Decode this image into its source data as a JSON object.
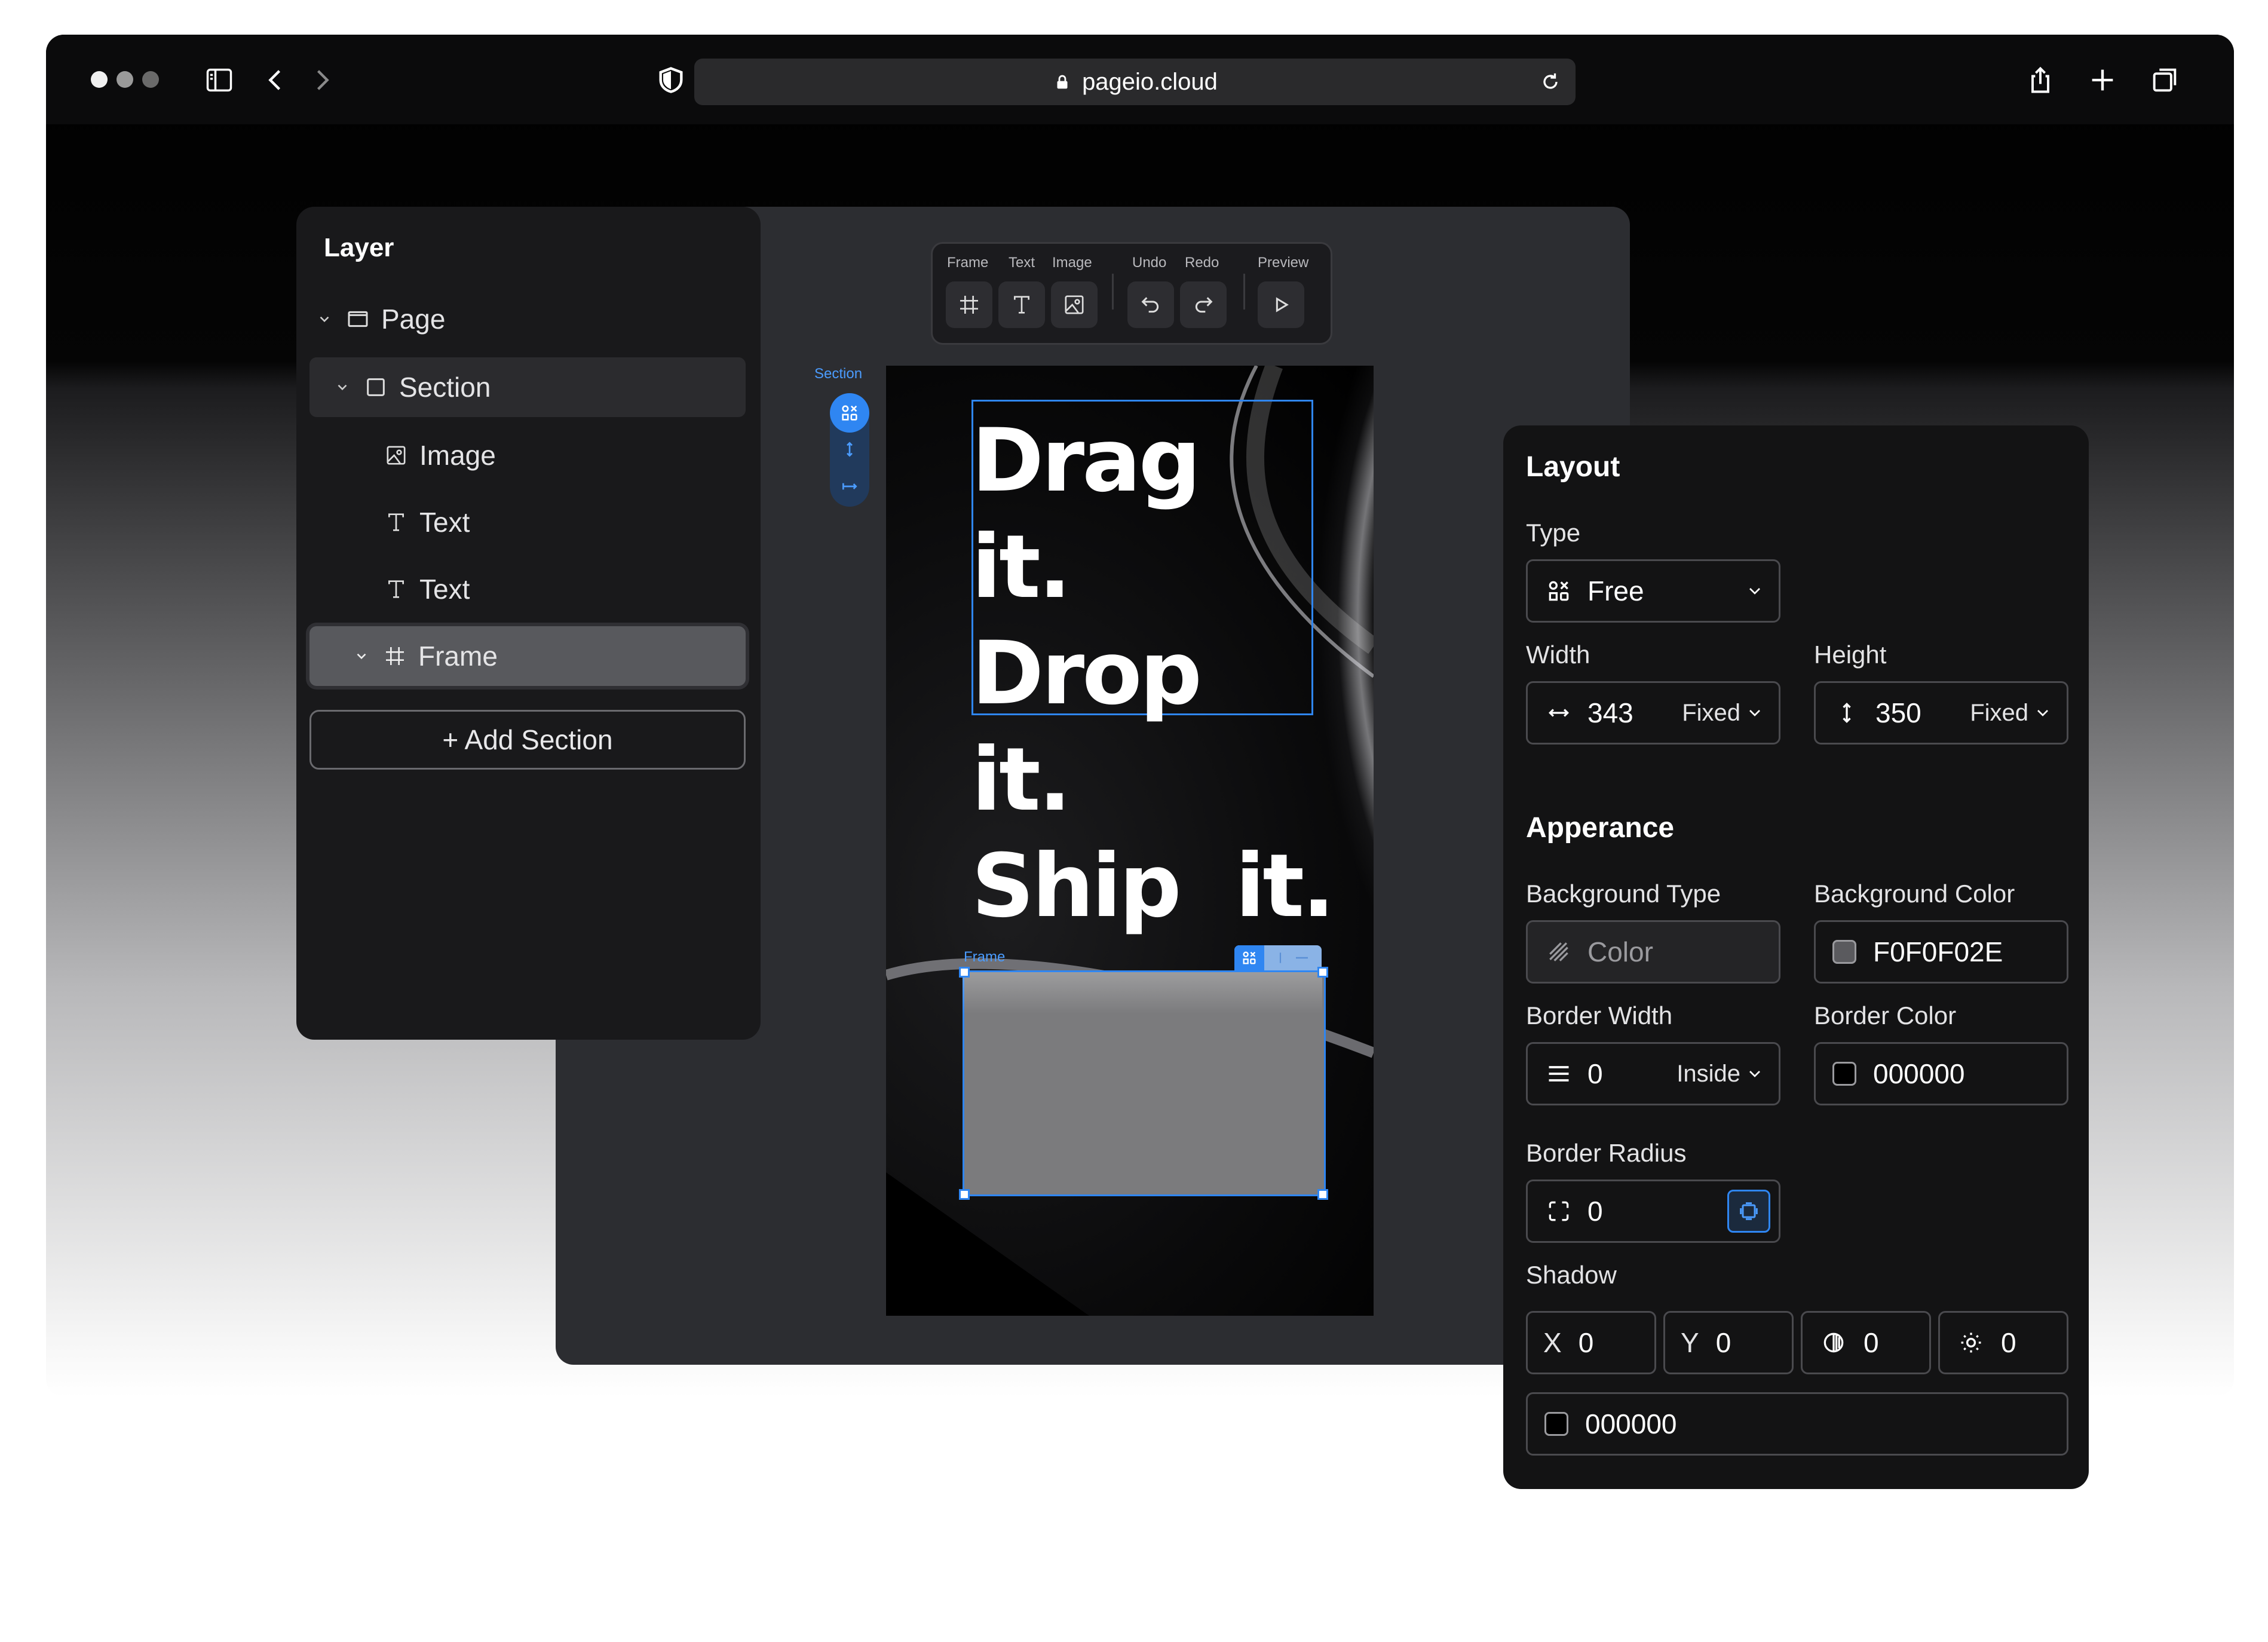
{
  "browser": {
    "url": "pageio.cloud",
    "traffic_light_colors": [
      "#f0f0f0",
      "#9a9a9a",
      "#6a6a6a"
    ]
  },
  "toolbar": {
    "labels": {
      "frame": "Frame",
      "text": "Text",
      "image": "Image",
      "undo": "Undo",
      "redo": "Redo",
      "preview": "Preview"
    }
  },
  "canvas": {
    "section_label": "Section",
    "hero_lines": [
      "Drag it.",
      "Drop it.",
      "Ship  it."
    ],
    "frame_label": "Frame",
    "accent": "#2f86f2"
  },
  "layer_panel": {
    "title": "Layer",
    "items": [
      {
        "label": "Page",
        "icon": "page-icon"
      },
      {
        "label": "Section",
        "icon": "square-icon"
      },
      {
        "label": "Image",
        "icon": "image-icon"
      },
      {
        "label": "Text",
        "icon": "text-icon"
      },
      {
        "label": "Text",
        "icon": "text-icon"
      },
      {
        "label": "Frame",
        "icon": "frame-hash-icon"
      }
    ],
    "add_section": "+ Add Section"
  },
  "properties": {
    "layout_title": "Layout",
    "type_label": "Type",
    "type_value": "Free",
    "width_label": "Width",
    "width_value": "343",
    "width_mode": "Fixed",
    "height_label": "Height",
    "height_value": "350",
    "height_mode": "Fixed",
    "appearance_title": "Apperance",
    "bg_type_label": "Background Type",
    "bg_type_value": "Color",
    "bg_color_label": "Background Color",
    "bg_color_value": "F0F0F02E",
    "border_width_label": "Border Width",
    "border_width_value": "0",
    "border_width_mode": "Inside",
    "border_color_label": "Border Color",
    "border_color_value": "000000",
    "border_radius_label": "Border Radius",
    "border_radius_value": "0",
    "shadow_label": "Shadow",
    "shadow_x_prefix": "X",
    "shadow_x": "0",
    "shadow_y_prefix": "Y",
    "shadow_y": "0",
    "shadow_blur": "0",
    "shadow_spread": "0",
    "shadow_color": "000000"
  }
}
